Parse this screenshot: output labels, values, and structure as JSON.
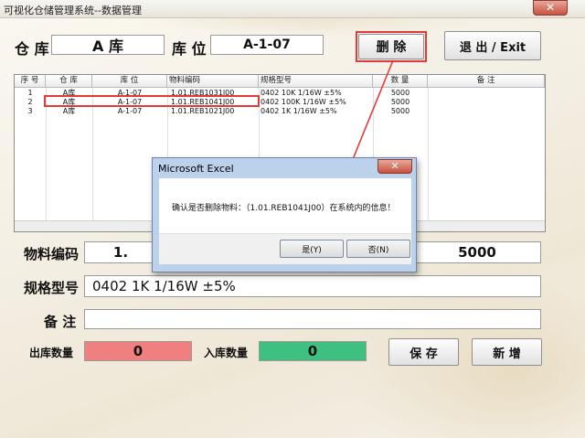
{
  "window": {
    "title": "可视化仓储管理系统--数据管理",
    "close_glyph": "✕"
  },
  "header": {
    "warehouse_label": "仓 库",
    "warehouse_value": "A 库",
    "location_label": "库 位",
    "location_value": "A-1-07",
    "delete_button": "删 除",
    "exit_button": "退 出 / Exit"
  },
  "table": {
    "columns": [
      "序 号",
      "仓 库",
      "库 位",
      "物料编码",
      "规格型号",
      "数 量",
      "备 注"
    ],
    "rows": [
      [
        "1",
        "A库",
        "A-1-07",
        "1.01.REB1031J00",
        "0402 10K 1/16W ±5%",
        "5000",
        ""
      ],
      [
        "2",
        "A库",
        "A-1-07",
        "1.01.REB1041J00",
        "0402 100K 1/16W ±5%",
        "5000",
        ""
      ],
      [
        "3",
        "A库",
        "A-1-07",
        "1.01.REB1021J00",
        "0402 1K 1/16W ±5%",
        "5000",
        ""
      ]
    ]
  },
  "form": {
    "material_code_label": "物料编码",
    "material_code_value": "1.",
    "quantity_value": "5000",
    "spec_label": "规格型号",
    "spec_value": "0402 1K 1/16W ±5%",
    "remark_label": "备 注",
    "remark_value": "",
    "out_qty_label": "出库数量",
    "out_qty_value": "0",
    "in_qty_label": "入库数量",
    "in_qty_value": "0",
    "save_button": "保 存",
    "add_button": "新 增"
  },
  "dialog": {
    "title": "Microsoft Excel",
    "close_glyph": "✕",
    "message": "确认是否删除物料：（1.01.REB1041J00）在系统内的信息！",
    "yes_button": "是(Y)",
    "no_button": "否(N)"
  },
  "colors": {
    "out_qty_bg": "#f08080",
    "in_qty_bg": "#40c080",
    "annotation": "#e23a3a"
  }
}
